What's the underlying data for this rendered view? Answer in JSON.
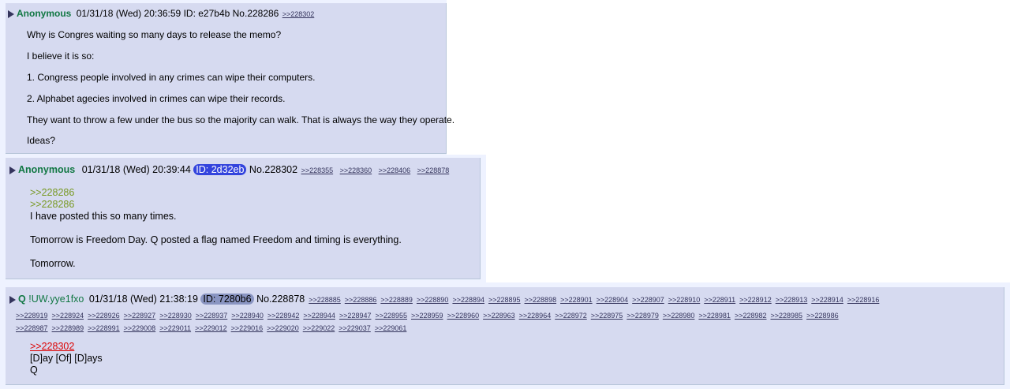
{
  "posts": [
    {
      "name": "Anonymous",
      "datetime": "01/31/18 (Wed) 20:36:59",
      "id_text": "ID: e27b4b",
      "number": "No.228286",
      "backlinks": [
        ">>228302"
      ],
      "lines": [
        "Why is Congres waiting so many days to release the memo?",
        "I believe it is so:",
        "1. Congress people involved in any crimes can wipe their computers.",
        "2. Alphabet agecies involved in crimes can wipe their records.",
        "They want to throw a few under the bus so the majority can walk. That is always the way they operate.",
        "Ideas?"
      ]
    },
    {
      "name": "Anonymous",
      "datetime": "01/31/18 (Wed) 20:39:44",
      "id_text": "ID: 2d32eb",
      "id_color": "#3344dd",
      "number": "No.228302",
      "backlinks": [
        ">>228355",
        ">>228360",
        ">>228406",
        ">>228878"
      ],
      "quotes": [
        ">>228286",
        ">>228286"
      ],
      "lines": [
        "I have posted this so many times.",
        "Tomorrow is Freedom Day. Q posted a flag named Freedom and timing is everything.",
        "Tomorrow."
      ]
    },
    {
      "name": "Q",
      "tripcode": "!UW.yye1fxo",
      "datetime": "01/31/18 (Wed) 21:38:19",
      "id_text": "ID: 7280b6",
      "id_color": "#8a95c2",
      "number": "No.228878",
      "backlinks_row1": [
        ">>228885",
        ">>228886",
        ">>228889",
        ">>228890",
        ">>228894",
        ">>228895",
        ">>228898",
        ">>228901",
        ">>228904",
        ">>228907",
        ">>228910",
        ">>228911",
        ">>228912",
        ">>228913",
        ">>228914",
        ">>228916"
      ],
      "backlinks_row2": [
        ">>228919",
        ">>228924",
        ">>228926",
        ">>228927",
        ">>228930",
        ">>228937",
        ">>228940",
        ">>228942",
        ">>228944",
        ">>228947",
        ">>228955",
        ">>228959",
        ">>228960",
        ">>228963",
        ">>228964",
        ">>228972",
        ">>228975",
        ">>228979",
        ">>228980",
        ">>228981",
        ">>228982",
        ">>228985",
        ">>228986"
      ],
      "backlinks_row3": [
        ">>228987",
        ">>228989",
        ">>228991",
        ">>229008",
        ">>229011",
        ">>229012",
        ">>229016",
        ">>229020",
        ">>229022",
        ">>229037",
        ">>229061"
      ],
      "quote_link": ">>228302",
      "lines": [
        "[D]ay [Of] [D]ays",
        "Q"
      ]
    }
  ],
  "colors": {
    "name": "#117743",
    "quote": "#789922",
    "link": "#34345c",
    "red_link": "#dd0000",
    "post_bg": "#d6daf0"
  }
}
